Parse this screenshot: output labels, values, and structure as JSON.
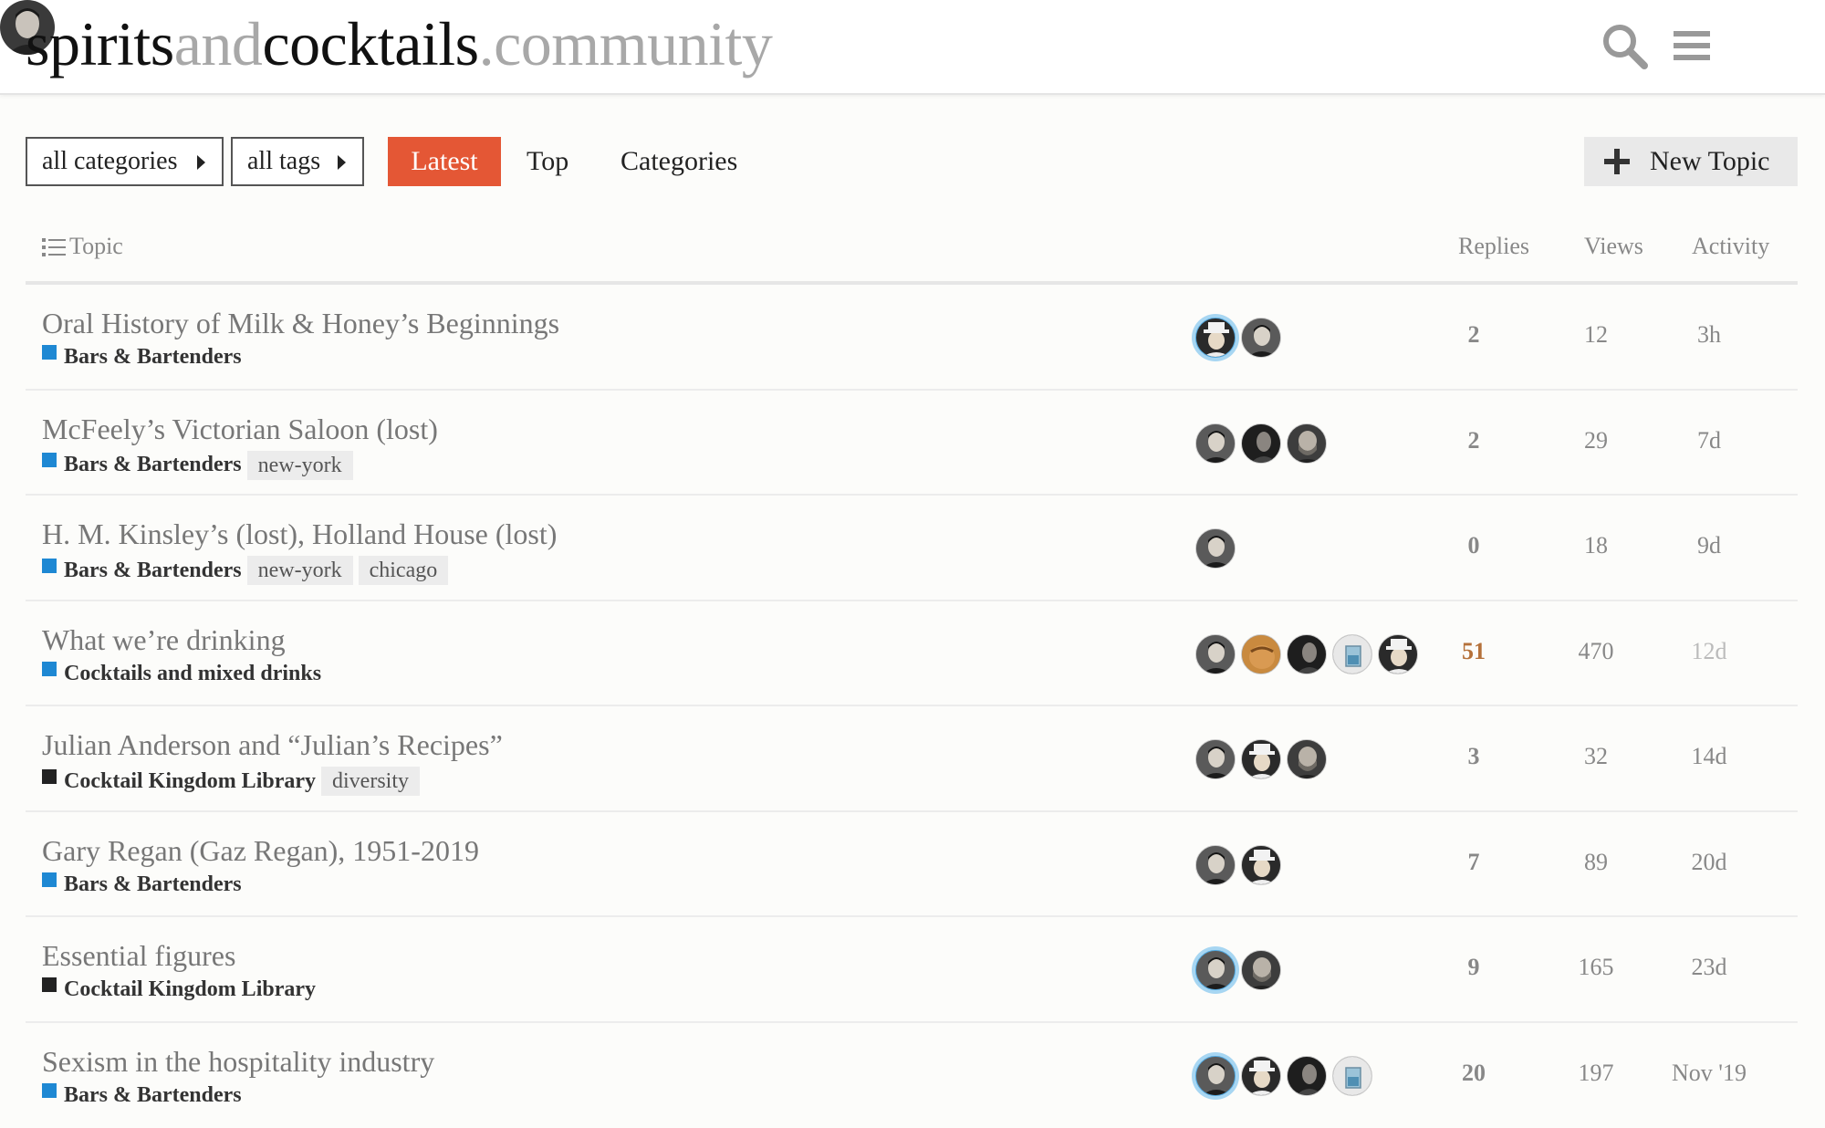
{
  "header": {
    "logo": {
      "part1": "spirits",
      "part2": "and",
      "part3": "cocktails",
      "part4": ".community"
    },
    "icons": [
      "search-icon",
      "hamburger-menu-icon",
      "user-avatar"
    ]
  },
  "nav": {
    "categories_dropdown": "all categories",
    "tags_dropdown": "all tags",
    "tabs": {
      "latest": "Latest",
      "top": "Top",
      "categories": "Categories"
    },
    "new_topic": "New Topic",
    "accent_color": "#e45735"
  },
  "columns": {
    "topic": "Topic",
    "replies": "Replies",
    "views": "Views",
    "activity": "Activity"
  },
  "category_colors": {
    "Bars & Bartenders": "#1e88d3",
    "Cocktails and mixed drinks": "#1e88d3",
    "Cocktail Kingdom Library": "#222222"
  },
  "topics": [
    {
      "title": "Oral History of Milk & Honey’s Beginnings",
      "category": "Bars & Bartenders",
      "tags": [],
      "posters": [
        "hat-man",
        "man-a"
      ],
      "highlight_first": true,
      "replies": "2",
      "views": "12",
      "activity": "3h"
    },
    {
      "title": "McFeely’s Victorian Saloon (lost)",
      "category": "Bars & Bartenders",
      "tags": [
        "new-york"
      ],
      "posters": [
        "man-a",
        "dark-man",
        "bearded-man"
      ],
      "highlight_first": false,
      "replies": "2",
      "views": "29",
      "activity": "7d"
    },
    {
      "title": "H. M. Kinsley’s (lost), Holland House (lost)",
      "category": "Bars & Bartenders",
      "tags": [
        "new-york",
        "chicago"
      ],
      "posters": [
        "man-a"
      ],
      "highlight_first": false,
      "replies": "0",
      "views": "18",
      "activity": "9d"
    },
    {
      "title": "What we’re drinking",
      "category": "Cocktails and mixed drinks",
      "tags": [],
      "posters": [
        "man-a",
        "orange-face",
        "dark-man",
        "glass-icon",
        "hat-man"
      ],
      "highlight_first": false,
      "replies": "51",
      "views": "470",
      "activity": "12d",
      "hot": true,
      "dim_activity": true
    },
    {
      "title": "Julian Anderson and “Julian’s Recipes”",
      "category": "Cocktail Kingdom Library",
      "tags": [
        "diversity"
      ],
      "posters": [
        "man-a",
        "hat-man",
        "bearded-man"
      ],
      "highlight_first": false,
      "replies": "3",
      "views": "32",
      "activity": "14d"
    },
    {
      "title": "Gary Regan (Gaz Regan), 1951-2019",
      "category": "Bars & Bartenders",
      "tags": [],
      "posters": [
        "man-a",
        "hat-man"
      ],
      "highlight_first": false,
      "replies": "7",
      "views": "89",
      "activity": "20d"
    },
    {
      "title": "Essential figures",
      "category": "Cocktail Kingdom Library",
      "tags": [],
      "posters": [
        "man-a",
        "bearded-man"
      ],
      "highlight_first": true,
      "replies": "9",
      "views": "165",
      "activity": "23d"
    },
    {
      "title": "Sexism in the hospitality industry",
      "category": "Bars & Bartenders",
      "tags": [],
      "posters": [
        "man-a",
        "hat-man",
        "dark-man",
        "glass-icon"
      ],
      "highlight_first": true,
      "replies": "20",
      "views": "197",
      "activity": "Nov '19"
    }
  ]
}
